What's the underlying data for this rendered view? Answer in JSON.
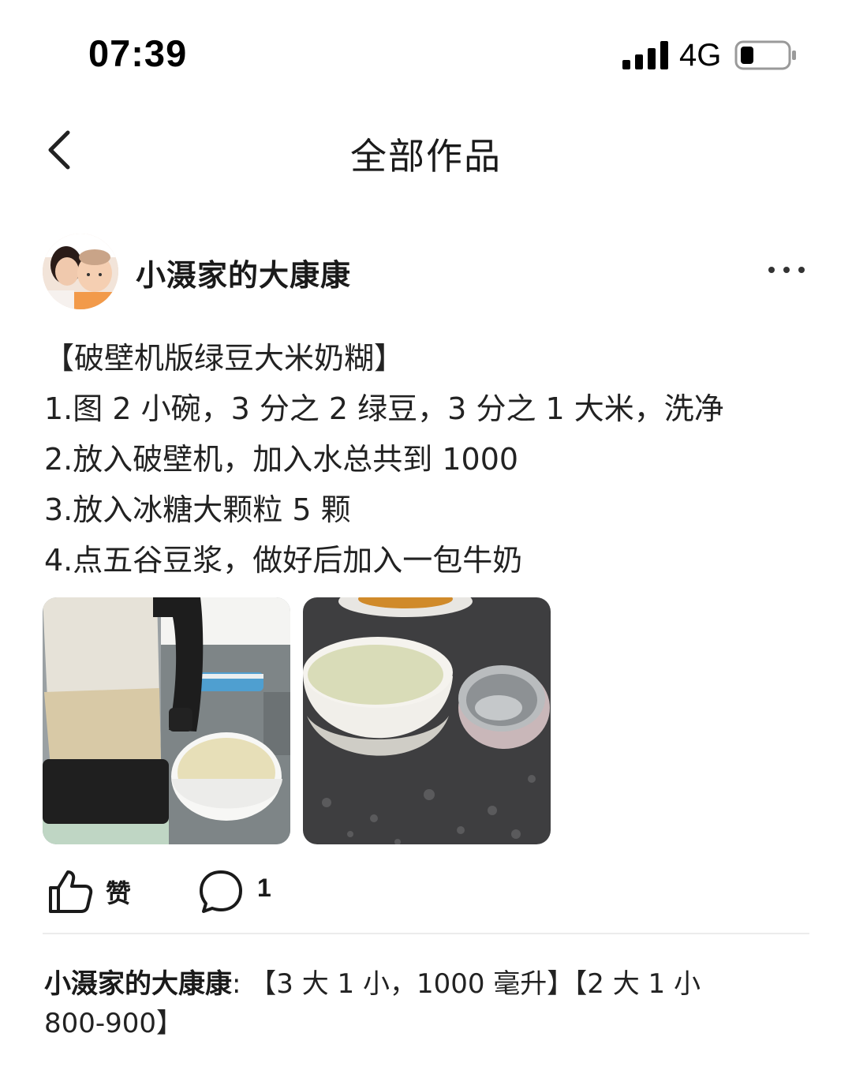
{
  "status_bar": {
    "time": "07:39",
    "network": "4G",
    "signal_icon": "cellular-signal-icon",
    "battery_icon": "battery-low-icon"
  },
  "nav": {
    "title": "全部作品",
    "back_icon": "chevron-left-icon"
  },
  "post": {
    "author": "小滠家的大康康",
    "more_icon": "more-horizontal-icon",
    "lines": [
      "【破壁机版绿豆大米奶糊】",
      "1.图 2 小碗，3 分之 2 绿豆，3 分之 1 大米，洗净",
      "2.放入破壁机，加入水总共到 1000",
      "3.放入冰糖大颗粒 5 颗",
      "4.点五谷豆浆，做好后加入一包牛奶"
    ],
    "images": [
      {
        "description_icon": "blender-photo"
      },
      {
        "description_icon": "bowls-photo"
      }
    ]
  },
  "actions": {
    "like_label": "赞",
    "like_icon": "thumbs-up-icon",
    "comment_icon": "comment-bubble-icon",
    "comment_count": "1"
  },
  "comment": {
    "author": "小滠家的大康康",
    "separator": ": ",
    "text": "【3 大 1 小，1000 毫升】【2 大 1 小 800-900】"
  },
  "colors": {
    "text": "#1a1a1a",
    "divider": "#ececec",
    "background": "#ffffff"
  }
}
